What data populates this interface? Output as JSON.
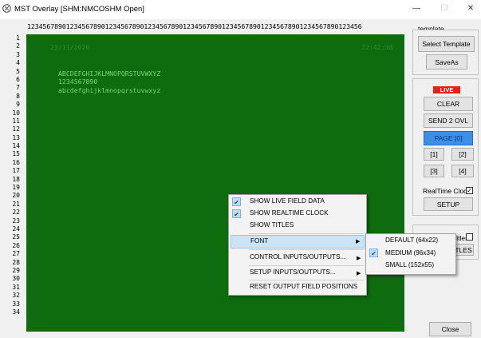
{
  "window": {
    "title": "MST Overlay  [SHM:NMCOSHM Open]",
    "minimize_icon": "minimize-icon",
    "maximize_icon": "maximize-icon",
    "close_icon": "close-icon",
    "minimize_glyph": "—",
    "maximize_glyph": "☐",
    "close_glyph": "✕"
  },
  "screen": {
    "column_ruler": "12345678901234567890123456789012345678901234567890123456789012345678901234567890123456",
    "row_numbers": [
      "1",
      "2",
      "3",
      "4",
      "5",
      "6",
      "7",
      "8",
      "9",
      "10",
      "11",
      "12",
      "13",
      "14",
      "15",
      "16",
      "17",
      "18",
      "19",
      "20",
      "21",
      "22",
      "23",
      "24",
      "25",
      "26",
      "27",
      "28",
      "29",
      "30",
      "31",
      "32",
      "33",
      "34"
    ],
    "date": "23/11/2020",
    "time": "22:42:38",
    "line1": "ABCDEFGHIJKLMNOPQRSTUVWXYZ",
    "line2": "1234567890",
    "line3": "abcdefghijklmnopqrstuvwxyz",
    "background_color": "#0e6b0e",
    "text_color": "#76d676"
  },
  "sidebar": {
    "template_label": "template",
    "select_template": "Select Template",
    "save_as": "SaveAs",
    "live_badge": "LIVE",
    "clear": "CLEAR",
    "send_2_ovl": "SEND 2 OVL",
    "page": "PAGE [0]",
    "page1": "[1]",
    "page2": "[2]",
    "page3": "[3]",
    "page4": "[4]",
    "realtime_clock_label": "RealTime Clock",
    "realtime_clock_checked": true,
    "setup": "SETUP",
    "show_titles_partial": "w Titles",
    "titles_btn_partial": "TLES",
    "close": "Close",
    "live_color": "#ec1c1c",
    "page_button_color": "#3c8ee7"
  },
  "context_menu": {
    "items": [
      {
        "label": "SHOW LIVE FIELD DATA",
        "checked": true
      },
      {
        "label": "SHOW REALTIME CLOCK",
        "checked": true
      },
      {
        "label": "SHOW TITLES",
        "checked": false
      },
      {
        "label": "FONT",
        "submenu": true,
        "highlighted": true
      },
      {
        "label": "CONTROL INPUTS/OUTPUTS...",
        "submenu": true
      },
      {
        "label": "SETUP INPUTS/OUTPUTS...",
        "submenu": true
      },
      {
        "label": "RESET OUTPUT FIELD POSITIONS"
      }
    ],
    "check_glyph": "✔",
    "arrow_glyph": "▶"
  },
  "font_submenu": {
    "items": [
      {
        "label": "DEFAULT (64x22)",
        "checked": false
      },
      {
        "label": "MEDIUM (96x34)",
        "checked": true
      },
      {
        "label": "SMALL (152x55)",
        "checked": false
      }
    ]
  }
}
